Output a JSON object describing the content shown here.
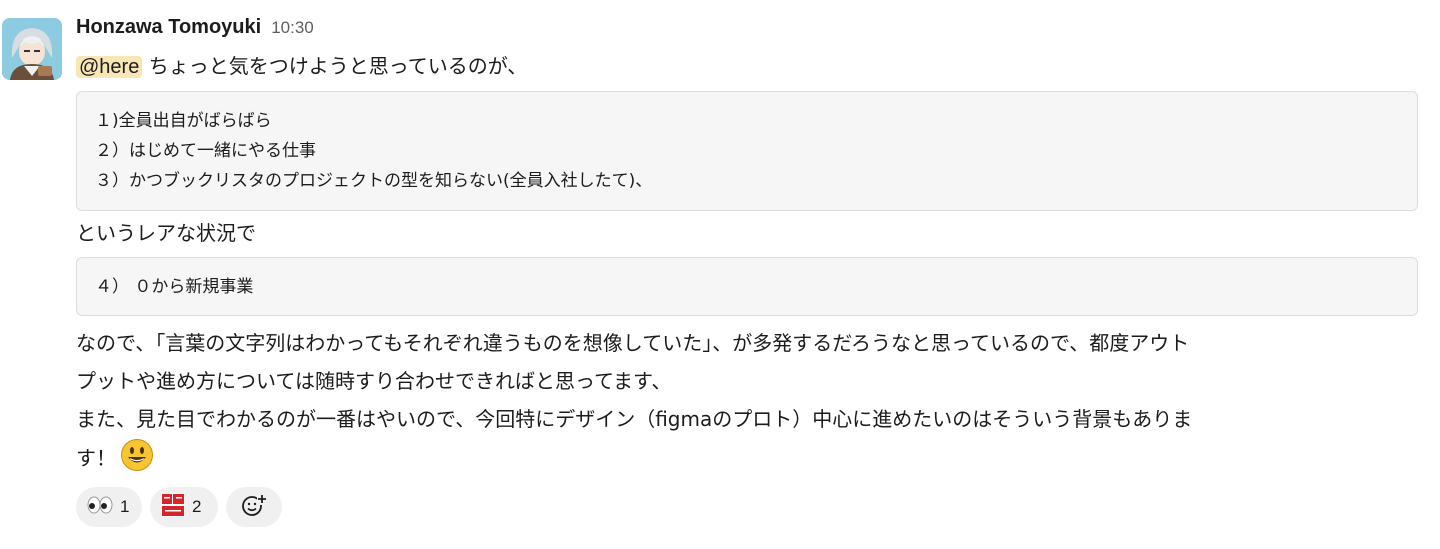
{
  "message": {
    "author": "Honzawa Tomoyuki",
    "time": "10:30",
    "mention": "@here",
    "intro": " ちょっと気をつけようと思っているのが、",
    "code_block_1": [
      "１)全員出自がばらばら",
      "２）はじめて一緒にやる仕事",
      "３）かつブックリスタのプロジェクトの型を知らない(全員入社したて)、"
    ],
    "middle": "というレアな状況で",
    "code_block_2": [
      "４） ０から新規事業"
    ],
    "paragraph_lines": [
      "なので、「言葉の文字列はわかってもそれぞれ違うものを想像していた」、が多発するだろうなと思っているので、都度アウト",
      "プットや進め方については随時すり合わせできればと思ってます、",
      "また、見た目でわかるのが一番はやいので、今回特にデザイン（figmaのプロト）中心に進めたいのはそういう背景もありま",
      "す！"
    ],
    "trailing_emoji": "smiley-icon"
  },
  "reactions": [
    {
      "icon": "eyes-icon",
      "count": "1"
    },
    {
      "icon": "ryokai-shimashita-icon",
      "count": "2"
    },
    {
      "icon": "add-reaction-icon",
      "count": ""
    }
  ],
  "colors": {
    "mention_bg": "#f8e6b4",
    "code_bg": "#f6f6f6",
    "reaction_bg": "#f0f0f0"
  }
}
